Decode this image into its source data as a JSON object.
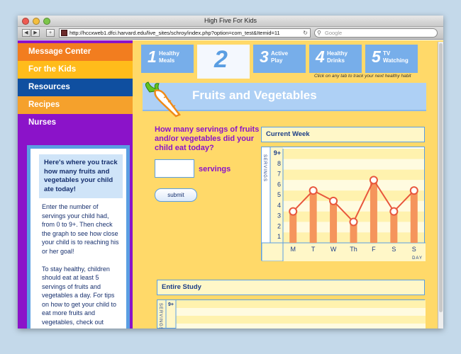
{
  "window": {
    "title": "High Five For Kids"
  },
  "browser": {
    "url": "http://hccxweb1.dfci.harvard.edu/live_sites/schroy/index.php?option=com_test&Itemid=11",
    "search_placeholder": "Google"
  },
  "sidebar": {
    "nav": [
      {
        "label": "Message Center"
      },
      {
        "label": "For the Kids"
      },
      {
        "label": "Resources"
      },
      {
        "label": "Recipes"
      },
      {
        "label": "Nurses"
      }
    ],
    "callout": "Here's where you track how many fruits and vegetables your child ate today!",
    "body": "Enter the number of servings your child had, from 0 to 9+. Then check the graph to see how close your child is to reaching his or her goal!\n\nTo stay healthy, children should eat at least 5 servings of fruits and vegetables a day. For tips on how to get your child to eat more fruits and vegetables, check out"
  },
  "tabs": [
    {
      "num": "1",
      "label": "Healthy\nMeals"
    },
    {
      "num": "2",
      "label": ""
    },
    {
      "num": "3",
      "label": "Active\nPlay"
    },
    {
      "num": "4",
      "label": "Healthy\nDrinks"
    },
    {
      "num": "5",
      "label": "TV\nWatching"
    }
  ],
  "tab_hint": "Click on any tab to track your next healthy habit",
  "section_title": "Fruits and Vegetables",
  "form": {
    "question": "How many servings of fruits and/or vegetables did your child eat today?",
    "input_value": "",
    "unit_label": "servings",
    "submit_label": "submit"
  },
  "current_week": {
    "header": "Current Week",
    "chart_data": {
      "type": "bar",
      "categories": [
        "M",
        "T",
        "W",
        "Th",
        "F",
        "S",
        "S"
      ],
      "values": [
        3,
        5,
        4,
        2,
        6,
        3,
        5
      ],
      "ylabel": "SERVINGS",
      "xlabel": "DAY",
      "y_ticks": [
        "1",
        "2",
        "3",
        "4",
        "5",
        "6",
        "7",
        "8",
        "9+"
      ],
      "ylim": [
        0,
        9
      ],
      "overlay": "line connecting daily values with circular markers"
    }
  },
  "entire_study": {
    "header": "Entire Study",
    "ylabel": "SERVINGS",
    "y_top": "9+"
  },
  "colors": {
    "orange": "#f27d1f",
    "purple": "#8b13c9",
    "blue": "#0f4fa0",
    "light_blue": "#5a9ee2",
    "yellow": "#ffd969",
    "bar": "#f5955c"
  }
}
